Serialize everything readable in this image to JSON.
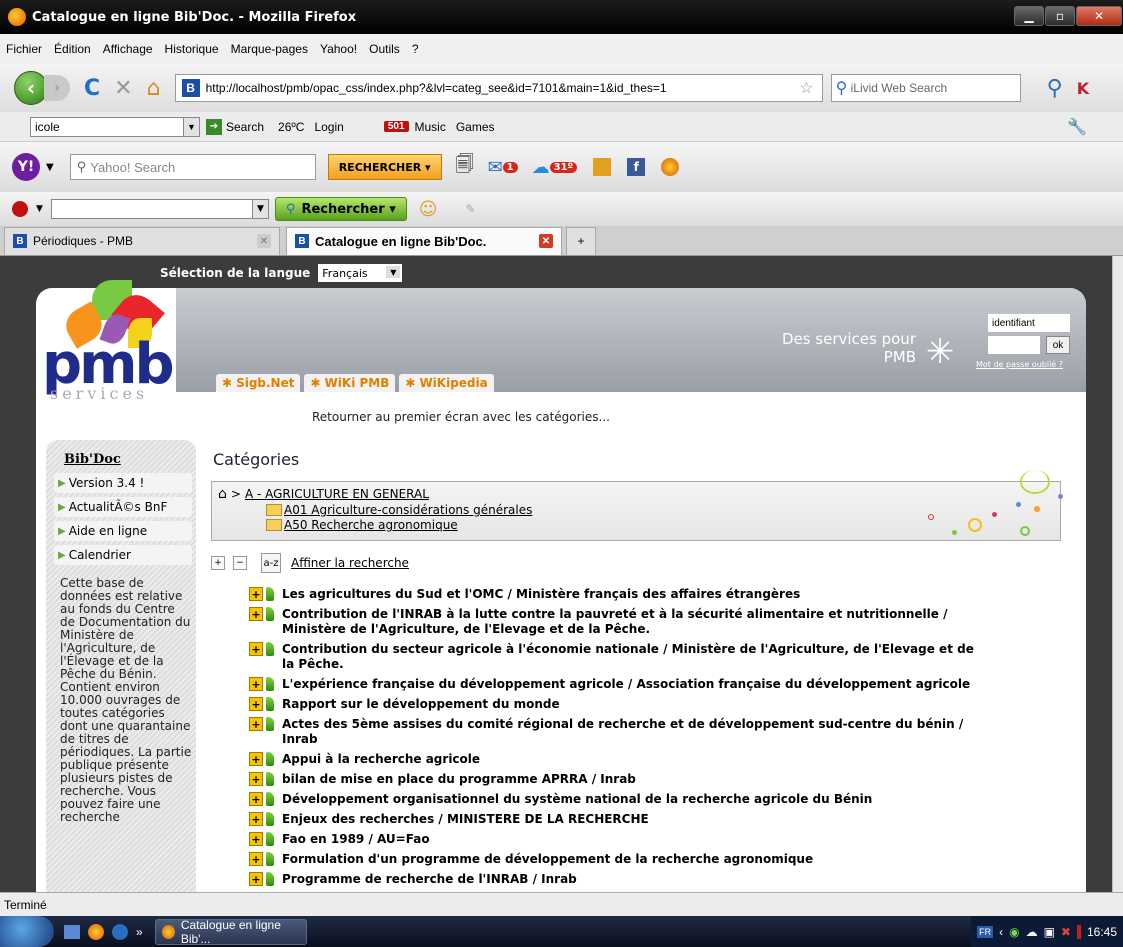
{
  "window": {
    "title": "Catalogue en ligne Bib'Doc. - Mozilla Firefox"
  },
  "menu": [
    "Fichier",
    "Édition",
    "Affichage",
    "Historique",
    "Marque-pages",
    "Yahoo!",
    "Outils",
    "?"
  ],
  "nav": {
    "url": "http://localhost/pmb/opac_css/index.php?&lvl=categ_see&id=7101&main=1&id_thes=1",
    "search_placeholder": "iLivid Web Search"
  },
  "toolbar1": {
    "combo_value": "icole",
    "search_label": "Search",
    "weather": "26ºC",
    "login_label": "Login",
    "music_badge": "501",
    "music_label": "Music",
    "games_label": "Games"
  },
  "yahoo": {
    "search_placeholder": "Yahoo! Search",
    "button_label": "RECHERCHER",
    "mail_badge": "1",
    "weather_badge": "31º"
  },
  "toolbar3": {
    "button_label": "Rechercher"
  },
  "tabs": [
    {
      "label": "Périodiques - PMB",
      "active": false
    },
    {
      "label": "Catalogue en ligne Bib'Doc.",
      "active": true
    }
  ],
  "lang": {
    "label": "Sélection de la langue",
    "value": "Français"
  },
  "header": {
    "logo": "pmb",
    "logo_sub": "services",
    "services_text": "Des services pour PMB",
    "login_placeholder": "identifiant",
    "ok_label": "ok",
    "forgot_label": "Mot de passe oublié ?",
    "links": [
      "Sigb.Net",
      "WiKi PMB",
      "WiKipedia"
    ],
    "return_link": "Retourner au premier écran avec les catégories..."
  },
  "sidebar": {
    "title": "Bib'Doc",
    "items": [
      "Version 3.4 !",
      "ActualitÃ©s BnF",
      "Aide en ligne",
      "Calendrier"
    ],
    "description": "Cette base de données est relative au fonds du Centre de Documentation du Ministère de l'Agriculture, de l'Élevage et de la Pêche du Bénin. Contient environ 10.000 ouvrages de toutes catégories dont une quarantaine de titres de périodiques. La partie publique présente plusieurs pistes de recherche. Vous pouvez faire une recherche"
  },
  "main": {
    "title": "Catégories",
    "breadcrumb_sep": ">",
    "path": "A - AGRICULTURE EN GENERAL",
    "subcategories": [
      "A01 Agriculture-considérations générales",
      "A50 Recherche agronomique"
    ],
    "az_label": "a-z",
    "refine_label": "Affiner la recherche",
    "results": [
      "Les agricultures du Sud et l'OMC / Ministère français des affaires étrangères",
      "Contribution de l'INRAB à la lutte contre la pauvreté et à la sécurité alimentaire et nutritionnelle / Ministère de l'Agriculture, de l'Elevage et de la Pêche.",
      "Contribution du secteur agricole à l'économie nationale / Ministère de l'Agriculture, de l'Elevage et de la Pêche.",
      "L'expérience française du développement agricole / Association française du développement agricole",
      "Rapport sur le développement du monde",
      "Actes des 5ème assises du comité régional de recherche et de développement sud-centre du bénin / Inrab",
      "Appui à la recherche agricole",
      "bilan de mise en place du programme APRRA / Inrab",
      "Développement organisationnel du système national de la recherche agricole du Bénin",
      "Enjeux des recherches / MINISTERE DE LA RECHERCHE",
      "Fao en 1989 / AU=Fao",
      "Formulation d'un programme de développement de la recherche agronomique",
      "Programme de recherche de l'INRAB / Inrab"
    ]
  },
  "status": {
    "text": "Terminé"
  },
  "taskbar": {
    "task_label": "Catalogue en ligne Bib'...",
    "lang": "FR",
    "time": "16:45"
  }
}
